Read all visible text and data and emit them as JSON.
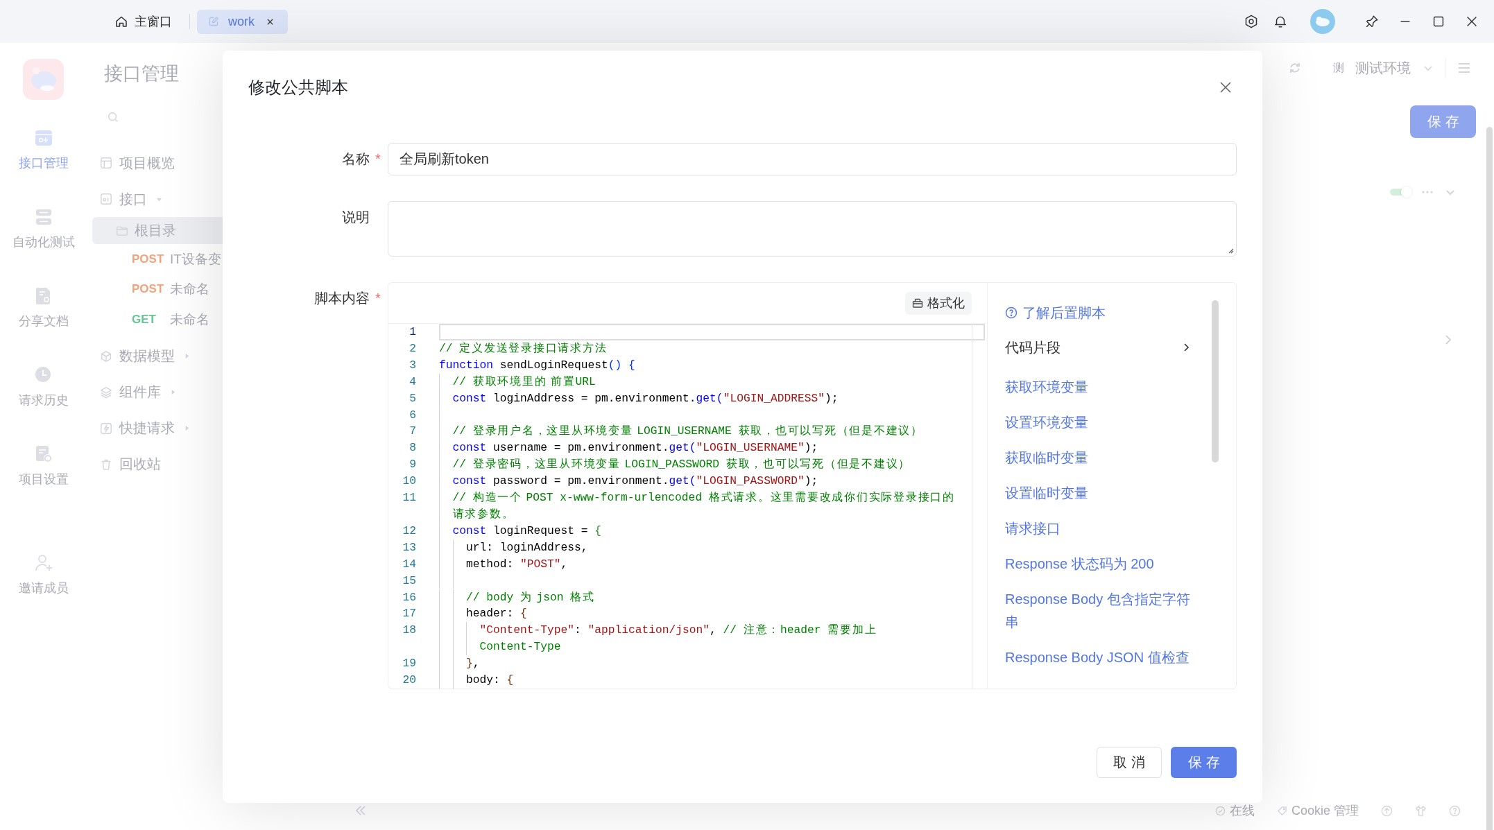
{
  "title_bar": {
    "tabs": [
      {
        "label": "主窗口",
        "kind": "home",
        "selected": false,
        "closable": false
      },
      {
        "label": "work",
        "kind": "document",
        "selected": true,
        "closable": true
      }
    ]
  },
  "background": {
    "rail": {
      "items": [
        {
          "label": "接口管理",
          "kind": "api",
          "selected": true
        },
        {
          "label": "自动化测试",
          "kind": "automation",
          "selected": false
        },
        {
          "label": "分享文档",
          "kind": "docs",
          "selected": false
        },
        {
          "label": "请求历史",
          "kind": "history",
          "selected": false
        },
        {
          "label": "项目设置",
          "kind": "project_settings",
          "selected": false
        }
      ],
      "footer_item": {
        "label": "邀请成员",
        "kind": "invite"
      }
    },
    "sidebar": {
      "title": "接口管理",
      "tree": [
        {
          "label": "项目概览",
          "kind": "overview",
          "selected": false
        },
        {
          "label": "接口",
          "kind": "api",
          "selected": false,
          "expanded": true,
          "children": [
            {
              "label": "根目录",
              "kind": "folder",
              "selected": true,
              "children": [
                {
                  "kind": "request",
                  "method": "POST",
                  "label": "IT设备变",
                  "color": "#f2a27c",
                  "selected": false
                },
                {
                  "kind": "request",
                  "method": "POST",
                  "label": "未命名",
                  "color": "#f2a27c",
                  "selected": false
                },
                {
                  "kind": "request",
                  "method": "GET",
                  "label": "未命名",
                  "color": "#66c495",
                  "selected": false
                }
              ]
            }
          ]
        },
        {
          "label": "数据模型",
          "kind": "model",
          "selected": false,
          "expanded": false
        },
        {
          "label": "组件库",
          "kind": "components",
          "selected": false,
          "expanded": false
        },
        {
          "label": "快捷请求",
          "kind": "shortcut",
          "selected": false,
          "expanded": false
        },
        {
          "label": "回收站",
          "kind": "trash",
          "selected": false
        }
      ]
    },
    "toolbar": {
      "environment_badge": "测",
      "environment": "测试环境",
      "save_button": "保存"
    },
    "switch": {
      "on": true
    },
    "status_bar": {
      "items": [
        {
          "label": "在线",
          "kind": "online"
        },
        {
          "label": "Cookie 管理",
          "kind": "cookie"
        }
      ]
    }
  },
  "dialog": {
    "title": "修改公共脚本",
    "fields": [
      {
        "label": "名称",
        "required_mark": "*",
        "kind": "input",
        "value": "全局刷新token"
      },
      {
        "label": "说明",
        "kind": "textarea"
      },
      {
        "label": "脚本内容",
        "required_mark": "*",
        "kind": "code"
      }
    ],
    "editor": {
      "format_button": "格式化",
      "lines": [
        {
          "number": "1",
          "active": true
        },
        {
          "number": "2",
          "active": false,
          "tokens": [
            {
              "text": "// 定义发送登录接口请求方法",
              "kind": "comment"
            }
          ]
        },
        {
          "number": "3",
          "active": false,
          "tokens": [
            {
              "text": "function",
              "kind": "keyword"
            },
            {
              "text": " sendLoginRequest",
              "kind": "text"
            },
            {
              "text": "() {",
              "kind": "bracket1"
            }
          ]
        },
        {
          "number": "4",
          "active": false,
          "tokens": [
            {
              "text": "  // 获取环境里的 前置URL",
              "kind": "comment"
            }
          ]
        },
        {
          "number": "5",
          "active": false,
          "tokens": [
            {
              "text": "  const",
              "kind": "keyword"
            },
            {
              "text": " loginAddress = pm.environment.",
              "kind": "text"
            },
            {
              "text": "get(",
              "kind": "method"
            },
            {
              "text": "\"LOGIN_ADDRESS\"",
              "kind": "string"
            },
            {
              "text": ");",
              "kind": "text"
            }
          ]
        },
        {
          "number": "6",
          "active": false
        },
        {
          "number": "7",
          "active": false,
          "tokens": [
            {
              "text": "  // 登录用户名，这里从环境变量 LOGIN_USERNAME 获取，也可以写死（但是不建议）",
              "kind": "comment"
            }
          ]
        },
        {
          "number": "8",
          "active": false,
          "tokens": [
            {
              "text": "  const",
              "kind": "keyword"
            },
            {
              "text": " username = pm.environment.",
              "kind": "text"
            },
            {
              "text": "get(",
              "kind": "method"
            },
            {
              "text": "\"LOGIN_USERNAME\"",
              "kind": "string"
            },
            {
              "text": ");",
              "kind": "text"
            }
          ]
        },
        {
          "number": "9",
          "active": false,
          "tokens": [
            {
              "text": "  // 登录密码，这里从环境变量 LOGIN_PASSWORD 获取，也可以写死（但是不建议）",
              "kind": "comment"
            }
          ]
        },
        {
          "number": "10",
          "active": false,
          "tokens": [
            {
              "text": "  const",
              "kind": "keyword"
            },
            {
              "text": " password = pm.environment.",
              "kind": "text"
            },
            {
              "text": "get(",
              "kind": "method"
            },
            {
              "text": "\"LOGIN_PASSWORD\"",
              "kind": "string"
            },
            {
              "text": ");",
              "kind": "text"
            }
          ]
        },
        {
          "number": "11",
          "active": false,
          "tokens": [
            {
              "text": "  // 构造一个 POST x-www-form-urlencoded 格式请求。这里需要改成你们实际登录接口的请求参数。",
              "kind": "comment"
            }
          ]
        },
        {
          "number": "12",
          "active": false,
          "tokens": [
            {
              "text": "  const",
              "kind": "keyword"
            },
            {
              "text": " loginRequest = ",
              "kind": "text"
            },
            {
              "text": "{",
              "kind": "bracket2"
            }
          ]
        },
        {
          "number": "13",
          "active": false,
          "tokens": [
            {
              "text": "    url: loginAddress,",
              "kind": "text"
            }
          ]
        },
        {
          "number": "14",
          "active": false,
          "tokens": [
            {
              "text": "    method: ",
              "kind": "text"
            },
            {
              "text": "\"POST\"",
              "kind": "string"
            },
            {
              "text": ",",
              "kind": "text"
            }
          ]
        },
        {
          "number": "15",
          "active": false
        },
        {
          "number": "16",
          "active": false,
          "tokens": [
            {
              "text": "    // body 为 json 格式",
              "kind": "comment"
            }
          ]
        },
        {
          "number": "17",
          "active": false,
          "tokens": [
            {
              "text": "    header: ",
              "kind": "text"
            },
            {
              "text": "{",
              "kind": "bracket3"
            }
          ]
        },
        {
          "number": "18",
          "active": false,
          "tokens": [
            {
              "text": "      \"Content-Type\"",
              "kind": "string"
            },
            {
              "text": ": ",
              "kind": "text"
            },
            {
              "text": "\"application/json\"",
              "kind": "string"
            },
            {
              "text": ", ",
              "kind": "text"
            },
            {
              "text": "// 注意：header 需要加上",
              "kind": "comment"
            },
            {
              "text": " Content-Type",
              "kind": "comment"
            }
          ]
        },
        {
          "number": "19",
          "active": false,
          "tokens": [
            {
              "text": "    }",
              "kind": "bracket3"
            },
            {
              "text": ",",
              "kind": "text"
            }
          ]
        },
        {
          "number": "20",
          "active": false,
          "tokens": [
            {
              "text": "    body: ",
              "kind": "text"
            },
            {
              "text": "{",
              "kind": "bracket3"
            }
          ]
        }
      ]
    },
    "snippets": {
      "help_link": "了解后置脚本",
      "section_title": "代码片段",
      "items": [
        "获取环境变量",
        "设置环境变量",
        "获取临时变量",
        "设置临时变量",
        "请求接口",
        "Response 状态码为 200",
        "Response Body 包含指定字符串",
        "Response Body JSON 值检查"
      ]
    },
    "buttons": [
      {
        "label": "取消",
        "kind": "secondary"
      },
      {
        "label": "保存",
        "kind": "primary"
      }
    ]
  }
}
